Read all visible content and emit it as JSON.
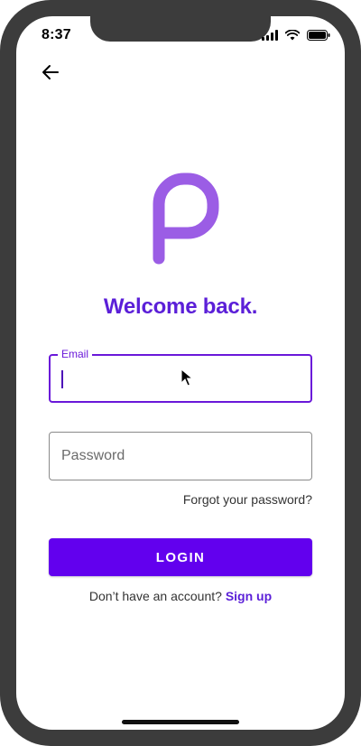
{
  "status_bar": {
    "time": "8:37"
  },
  "header": {
    "back_icon": "arrow-left-icon"
  },
  "logo": {
    "letter_icon": "p-logo-icon",
    "color": "#9b5de5"
  },
  "title": "Welcome back.",
  "email_field": {
    "label": "Email",
    "value": "",
    "placeholder": ""
  },
  "password_field": {
    "value": "",
    "placeholder": "Password"
  },
  "forgot_password": "Forgot your password?",
  "login_button": "LOGIN",
  "signup": {
    "prompt": "Don’t have an account?",
    "link": "Sign up"
  },
  "colors": {
    "accent": "#6200ee",
    "title": "#5b1fd8",
    "frame": "#3c3c3c"
  }
}
